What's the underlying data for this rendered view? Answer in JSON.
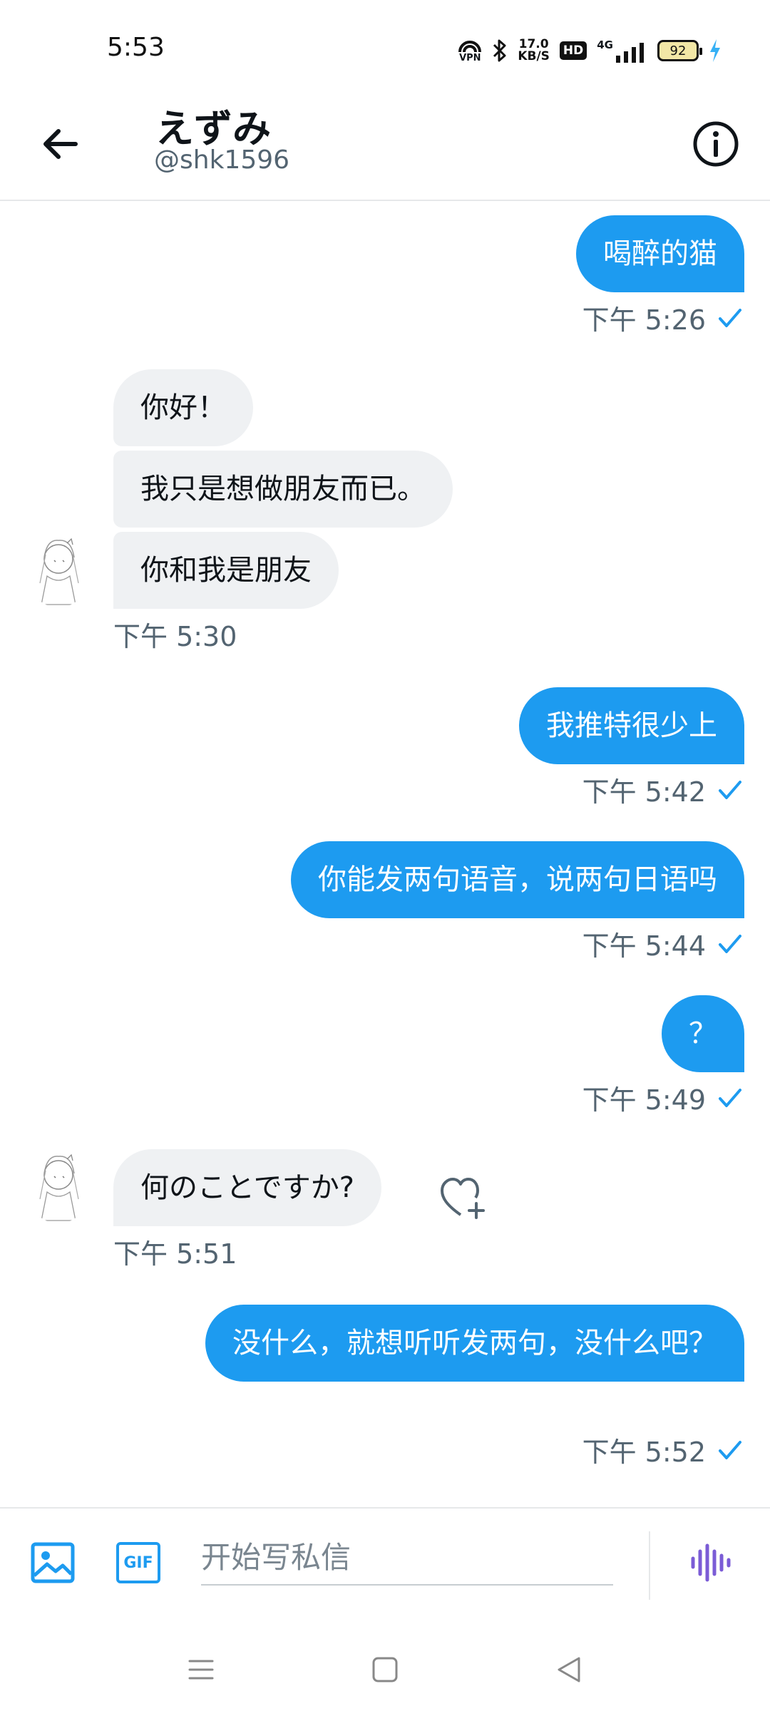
{
  "status_bar": {
    "time": "5:53",
    "vpn_label": "VPN",
    "net_speed_value": "17.0",
    "net_speed_unit": "KB/S",
    "hd_label": "HD",
    "signal_label": "4G",
    "battery_level": "92"
  },
  "header": {
    "name": "えずみ",
    "handle": "@shk1596"
  },
  "messages": [
    {
      "direction": "out",
      "text": "喝醉的猫",
      "time": "下午 5:26"
    },
    {
      "direction": "in",
      "text": "你好！"
    },
    {
      "direction": "in",
      "text": "我只是想做朋友而已。"
    },
    {
      "direction": "in",
      "text": "你和我是朋友",
      "time": "下午 5:30"
    },
    {
      "direction": "out",
      "text": "我推特很少上",
      "time": "下午 5:42"
    },
    {
      "direction": "out",
      "text": "你能发两句语音，说两句日语吗",
      "time": "下午 5:44"
    },
    {
      "direction": "out",
      "text": "？",
      "time": "下午 5:49"
    },
    {
      "direction": "in",
      "text": "何のことですか?",
      "time": "下午 5:51"
    },
    {
      "direction": "out",
      "text": "没什么，就想听听发两句，没什么吧？",
      "time": "下午 5:52"
    }
  ],
  "composer": {
    "gif_label": "GIF",
    "placeholder": "开始写私信"
  },
  "colors": {
    "accent": "#1d9bf0",
    "incoming_bubble": "#eff1f3",
    "secondary_text": "#536471",
    "voice_icon": "#7b5cd6"
  },
  "icons": {
    "back": "arrow-left-icon",
    "info": "info-icon",
    "sent_status": "check-icon",
    "react": "heart-plus-icon",
    "image": "image-icon",
    "gif": "gif-icon",
    "voice": "voice-wave-icon"
  }
}
